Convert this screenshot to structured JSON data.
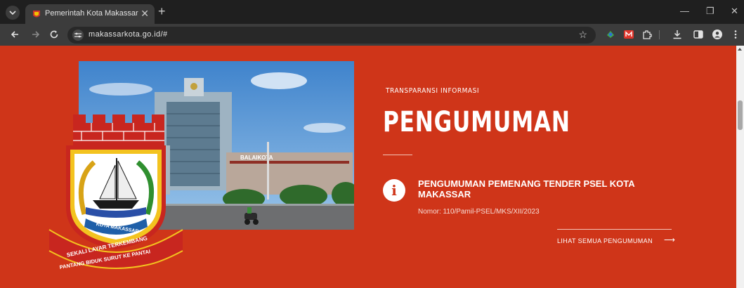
{
  "browser": {
    "tab_title": "Pemerintah Kota Makassar",
    "tab_close": "✕",
    "new_tab": "+",
    "url": "makassarkota.go.id/#",
    "controls": {
      "minimize": "—",
      "restore": "❐",
      "close": "✕"
    }
  },
  "icons": {
    "tab_menu": "chevron-down-icon",
    "back": "arrow-left-icon",
    "forward": "arrow-right-icon",
    "reload": "reload-icon",
    "site_info": "tune-icon",
    "bookmark": "star-icon",
    "extensions": [
      "green-extension-icon",
      "red-m-extension-icon",
      "puzzle-icon",
      "download-icon",
      "sidepanel-icon",
      "profile-icon",
      "kebab-menu-icon"
    ],
    "announcement": "info-icon",
    "more_arrow": "arrow-right-icon"
  },
  "colors": {
    "page_background": "#cf3519",
    "browser_frame": "#1f1f1f",
    "toolbar": "#3c3c3c",
    "text": "#ffffff"
  },
  "hero": {
    "eyebrow": "TRANSPARANSI INFORMASI",
    "heading": "PENGUMUMAN",
    "announcement": {
      "title": "PENGUMUMAN PEMENANG TENDER PSEL KOTA MAKASSAR",
      "number": "Nomor: 110/Pamil-PSEL/MKS/XII/2023"
    },
    "more_link": "LIHAT SEMUA PENGUMUMAN",
    "more_arrow": "⟶"
  },
  "images": {
    "building_sign": "BALAIKOTA"
  },
  "emblem": {
    "ribbon_line_1": "SEKALI LAYAR TERKEMBANG",
    "ribbon_line_2": "PANTANG BIDUK SURUT KE PANTAI",
    "shield_text": "KOTA MAKASSAR"
  }
}
